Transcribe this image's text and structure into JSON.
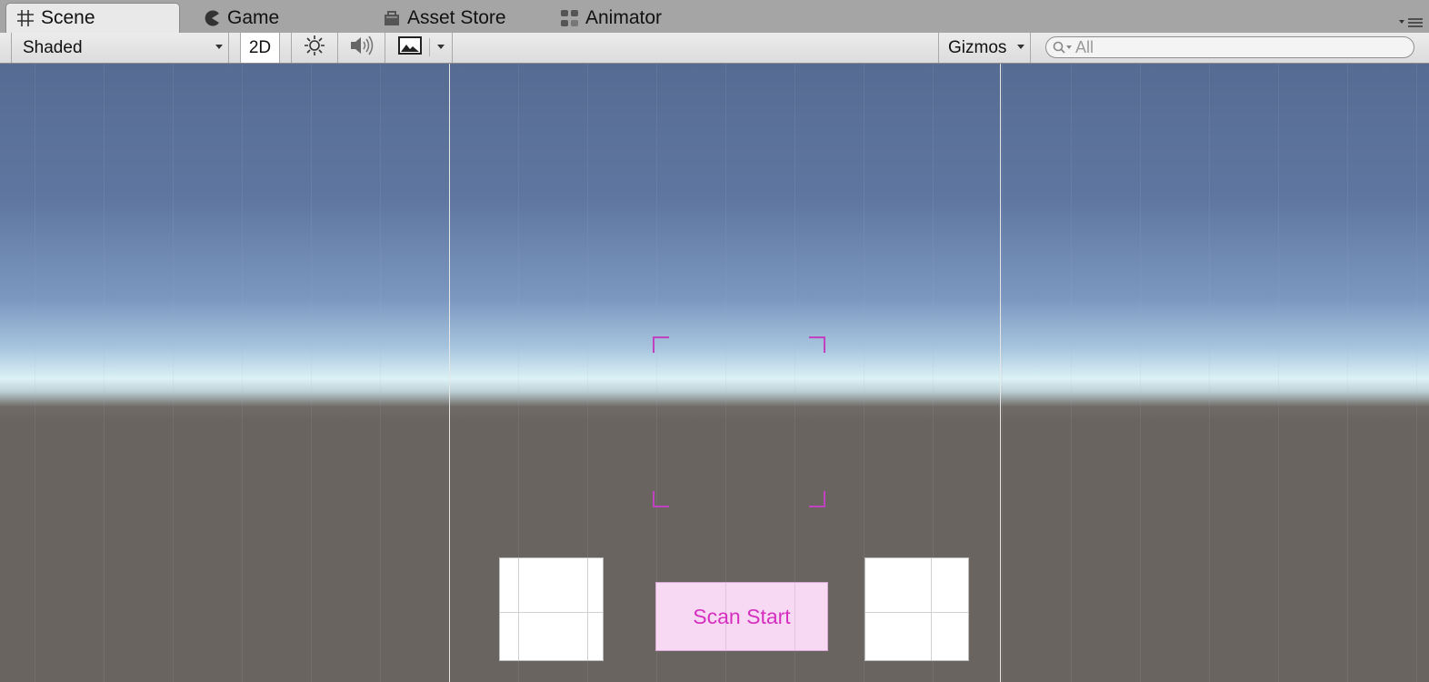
{
  "tabs": [
    {
      "label": "Scene",
      "icon": "grid-icon",
      "active": true
    },
    {
      "label": "Game",
      "icon": "pacman-icon",
      "active": false
    },
    {
      "label": "Asset Store",
      "icon": "shopping-bag-icon",
      "active": false
    },
    {
      "label": "Animator",
      "icon": "animator-nodes-icon",
      "active": false
    }
  ],
  "toolbar": {
    "draw_mode": "Shaded",
    "mode_2d": "2D",
    "lighting_icon": "sun-icon",
    "audio_icon": "speaker-icon",
    "effects_icon": "image-icon",
    "gizmos_label": "Gizmos",
    "search_placeholder": "All"
  },
  "scene": {
    "button_label": "Scan Start",
    "accent_color": "#d62fc0"
  }
}
